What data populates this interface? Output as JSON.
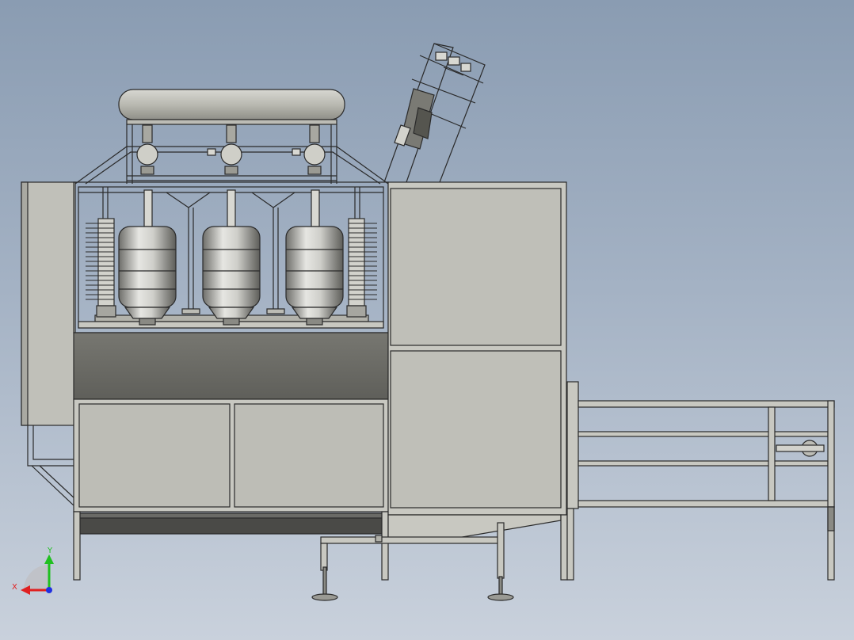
{
  "viewport": {
    "background_top": "#8a9cb2",
    "background_bottom": "#c9d1dc"
  },
  "model": {
    "bottle_count": 3,
    "brush_columns": 2,
    "colors": {
      "frame": "#c4c4bc",
      "frame_stroke": "#2a2a2a",
      "panel": "#bfbfb8",
      "dark_panel": "#6b6b66",
      "tank": "#b9b9b1",
      "bottle_light": "#e6e6e2",
      "bottle_dark": "#6e6e6a"
    }
  },
  "triad": {
    "x_label": "X",
    "y_label": "Y",
    "x_color": "#e02020",
    "y_color": "#20c020",
    "z_color": "#2030e0"
  }
}
